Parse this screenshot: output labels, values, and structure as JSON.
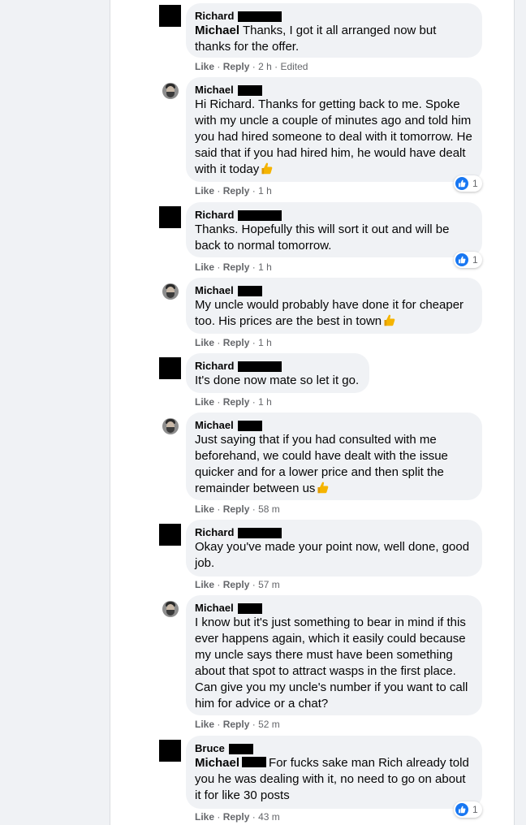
{
  "comments": [
    {
      "author": "Richard",
      "mention": "Michael",
      "text": "Thanks, I got it all arranged now but thanks for the offer.",
      "like": "Like",
      "reply": "Reply",
      "time": "2 h",
      "edited": "Edited",
      "avatar": "redacted"
    },
    {
      "author": "Michael",
      "text": "Hi Richard. Thanks for getting back to me. Spoke with my uncle a couple of minutes ago and told him you had hired someone to deal with it tomorrow. He said that if you had hired him, he would have dealt with it today",
      "emoji": "thumbs-up-emoji",
      "like": "Like",
      "reply": "Reply",
      "time": "1 h",
      "reaction_count": "1",
      "avatar": "photo"
    },
    {
      "author": "Richard",
      "text": "Thanks. Hopefully this will sort it out and will be back to normal tomorrow.",
      "like": "Like",
      "reply": "Reply",
      "time": "1 h",
      "reaction_count": "1",
      "avatar": "redacted"
    },
    {
      "author": "Michael",
      "text": "My uncle would probably have done it for cheaper too. His prices are the best in town",
      "emoji": "thumbs-up-emoji",
      "like": "Like",
      "reply": "Reply",
      "time": "1 h",
      "avatar": "photo"
    },
    {
      "author": "Richard",
      "text": "It's done now mate so let it go.",
      "like": "Like",
      "reply": "Reply",
      "time": "1 h",
      "avatar": "redacted"
    },
    {
      "author": "Michael",
      "text": "Just saying that if you had consulted with me beforehand, we could have dealt with the issue quicker and for a lower price and then split the remainder between us",
      "emoji": "thumbs-up-emoji",
      "like": "Like",
      "reply": "Reply",
      "time": "58 m",
      "avatar": "photo"
    },
    {
      "author": "Richard",
      "text": "Okay you've made your point now, well done, good job.",
      "like": "Like",
      "reply": "Reply",
      "time": "57 m",
      "avatar": "redacted"
    },
    {
      "author": "Michael",
      "text": "I know but it's just something to bear in mind if this ever happens again, which it easily could because my uncle says there must have been something about that spot to attract wasps in the first place. Can give you my uncle's number if you want to call him for advice or a chat?",
      "like": "Like",
      "reply": "Reply",
      "time": "52 m",
      "avatar": "photo"
    },
    {
      "author": "Bruce",
      "mention": "Michael",
      "text": "For fucks sake man Rich already told you he was dealing with it, no need to go on about it for like 30 posts",
      "like": "Like",
      "reply": "Reply",
      "time": "43 m",
      "reaction_count": "1",
      "avatar": "redacted"
    }
  ],
  "separator": "·",
  "colors": {
    "like_blue": "#1877f2",
    "bubble": "#f0f2f5",
    "meta": "#65676b"
  }
}
